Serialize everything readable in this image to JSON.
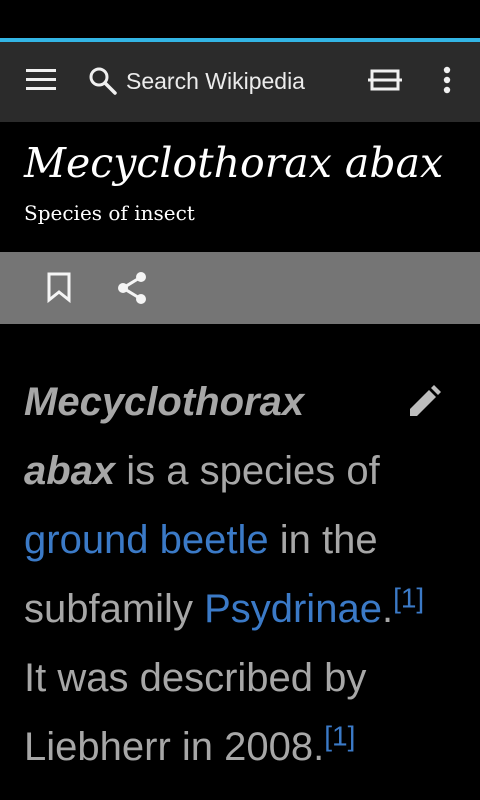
{
  "app": {
    "accent_color": "#33b5e5",
    "link_color": "#3b7ac7"
  },
  "toolbar": {
    "search_placeholder": "Search Wikipedia",
    "icons": [
      "menu-icon",
      "search-icon",
      "tabs-icon",
      "overflow-menu-icon"
    ]
  },
  "header": {
    "title": "Mecyclothorax abax",
    "description": "Species of insect"
  },
  "page_actions": {
    "icons": [
      "bookmark-icon",
      "share-icon"
    ]
  },
  "article": {
    "bold_term": "Mecyclothorax abax",
    "text_1": " is a species of ",
    "link_1": "ground beetle",
    "text_2": " in the subfamily ",
    "link_2": "Psydrinae",
    "text_3": ".",
    "ref_1": "[1]",
    "text_4": " It was described by Liebherr in 2008.",
    "ref_2": "[1]"
  }
}
